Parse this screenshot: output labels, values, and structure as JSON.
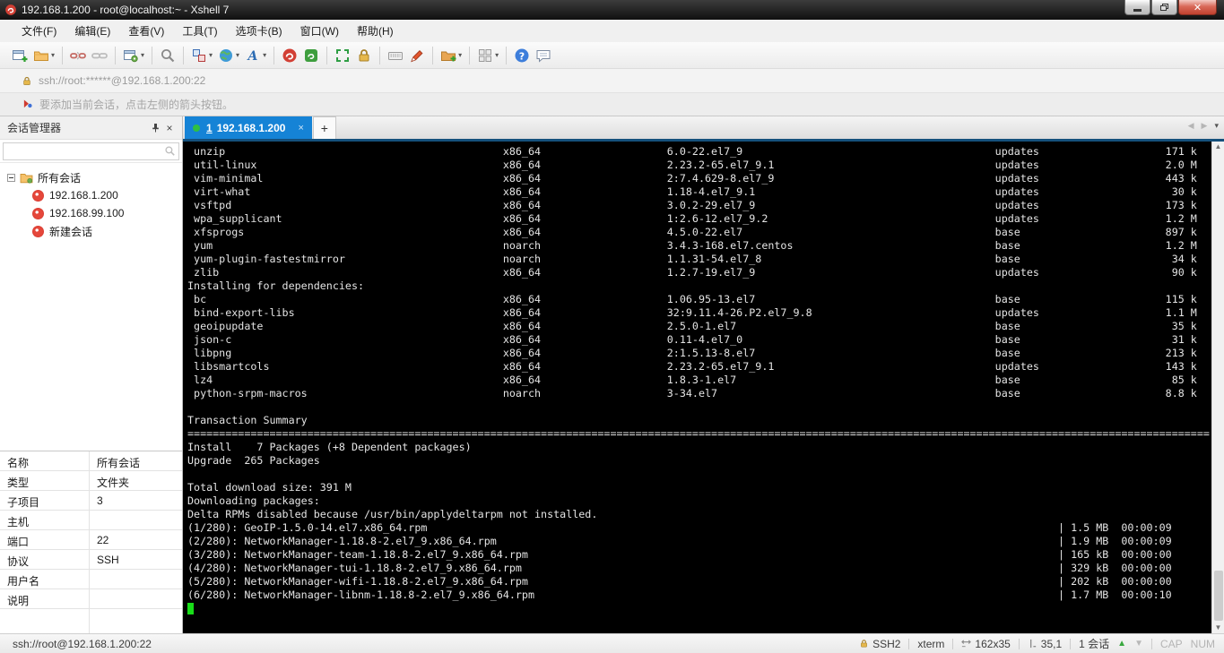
{
  "window": {
    "title": "192.168.1.200 - root@localhost:~ - Xshell 7"
  },
  "menu": {
    "items": [
      "文件(F)",
      "编辑(E)",
      "查看(V)",
      "工具(T)",
      "选项卡(B)",
      "窗口(W)",
      "帮助(H)"
    ]
  },
  "toolbar": {
    "icons": [
      "new-session",
      "open-folder",
      "disconnect",
      "reconnect",
      "session-properties",
      "find",
      "layout-panes",
      "web-browser",
      "font",
      "new-xshell-session",
      "new-xftp-session",
      "fullscreen",
      "lock-screen",
      "virtual-keyboard",
      "highlighter",
      "file-transfer",
      "tile-windows",
      "help",
      "feedback"
    ]
  },
  "address_bar": {
    "value": "ssh://root:******@192.168.1.200:22"
  },
  "info_bar": {
    "text": "要添加当前会话，点击左侧的箭头按钮。"
  },
  "session_manager": {
    "title": "会话管理器",
    "search_value": "",
    "tree": {
      "root": "所有会话",
      "sessions": [
        "192.168.1.200",
        "192.168.99.100",
        "新建会话"
      ]
    },
    "properties": [
      {
        "label": "名称",
        "value": "所有会话"
      },
      {
        "label": "类型",
        "value": "文件夹"
      },
      {
        "label": "子项目",
        "value": "3"
      },
      {
        "label": "主机",
        "value": ""
      },
      {
        "label": "端口",
        "value": "22"
      },
      {
        "label": "协议",
        "value": "SSH"
      },
      {
        "label": "用户名",
        "value": ""
      },
      {
        "label": "说明",
        "value": ""
      }
    ]
  },
  "tabs": {
    "active_index": "1",
    "active_label": "192.168.1.200",
    "close": "×",
    "new_tab": "+"
  },
  "terminal": {
    "columns": 162,
    "sep_char": "=",
    "lines": [
      {
        "t": "pkg",
        "name": "unzip",
        "arch": "x86_64",
        "ver": "6.0-22.el7_9",
        "repo": "updates",
        "size": "171 k"
      },
      {
        "t": "pkg",
        "name": "util-linux",
        "arch": "x86_64",
        "ver": "2.23.2-65.el7_9.1",
        "repo": "updates",
        "size": "2.0 M"
      },
      {
        "t": "pkg",
        "name": "vim-minimal",
        "arch": "x86_64",
        "ver": "2:7.4.629-8.el7_9",
        "repo": "updates",
        "size": "443 k"
      },
      {
        "t": "pkg",
        "name": "virt-what",
        "arch": "x86_64",
        "ver": "1.18-4.el7_9.1",
        "repo": "updates",
        "size": "30 k"
      },
      {
        "t": "pkg",
        "name": "vsftpd",
        "arch": "x86_64",
        "ver": "3.0.2-29.el7_9",
        "repo": "updates",
        "size": "173 k"
      },
      {
        "t": "pkg",
        "name": "wpa_supplicant",
        "arch": "x86_64",
        "ver": "1:2.6-12.el7_9.2",
        "repo": "updates",
        "size": "1.2 M"
      },
      {
        "t": "pkg",
        "name": "xfsprogs",
        "arch": "x86_64",
        "ver": "4.5.0-22.el7",
        "repo": "base",
        "size": "897 k"
      },
      {
        "t": "pkg",
        "name": "yum",
        "arch": "noarch",
        "ver": "3.4.3-168.el7.centos",
        "repo": "base",
        "size": "1.2 M"
      },
      {
        "t": "pkg",
        "name": "yum-plugin-fastestmirror",
        "arch": "noarch",
        "ver": "1.1.31-54.el7_8",
        "repo": "base",
        "size": "34 k"
      },
      {
        "t": "pkg",
        "name": "zlib",
        "arch": "x86_64",
        "ver": "1.2.7-19.el7_9",
        "repo": "updates",
        "size": "90 k"
      },
      {
        "t": "txt",
        "text": "Installing for dependencies:"
      },
      {
        "t": "pkg",
        "name": "bc",
        "arch": "x86_64",
        "ver": "1.06.95-13.el7",
        "repo": "base",
        "size": "115 k"
      },
      {
        "t": "pkg",
        "name": "bind-export-libs",
        "arch": "x86_64",
        "ver": "32:9.11.4-26.P2.el7_9.8",
        "repo": "updates",
        "size": "1.1 M"
      },
      {
        "t": "pkg",
        "name": "geoipupdate",
        "arch": "x86_64",
        "ver": "2.5.0-1.el7",
        "repo": "base",
        "size": "35 k"
      },
      {
        "t": "pkg",
        "name": "json-c",
        "arch": "x86_64",
        "ver": "0.11-4.el7_0",
        "repo": "base",
        "size": "31 k"
      },
      {
        "t": "pkg",
        "name": "libpng",
        "arch": "x86_64",
        "ver": "2:1.5.13-8.el7",
        "repo": "base",
        "size": "213 k"
      },
      {
        "t": "pkg",
        "name": "libsmartcols",
        "arch": "x86_64",
        "ver": "2.23.2-65.el7_9.1",
        "repo": "updates",
        "size": "143 k"
      },
      {
        "t": "pkg",
        "name": "lz4",
        "arch": "x86_64",
        "ver": "1.8.3-1.el7",
        "repo": "base",
        "size": "85 k"
      },
      {
        "t": "pkg",
        "name": "python-srpm-macros",
        "arch": "noarch",
        "ver": "3-34.el7",
        "repo": "base",
        "size": "8.8 k"
      },
      {
        "t": "blank"
      },
      {
        "t": "txt",
        "text": "Transaction Summary"
      },
      {
        "t": "sep"
      },
      {
        "t": "txt",
        "text": "Install    7 Packages (+8 Dependent packages)"
      },
      {
        "t": "txt",
        "text": "Upgrade  265 Packages"
      },
      {
        "t": "blank"
      },
      {
        "t": "txt",
        "text": "Total download size: 391 M"
      },
      {
        "t": "txt",
        "text": "Downloading packages:"
      },
      {
        "t": "txt",
        "text": "Delta RPMs disabled because /usr/bin/applydeltarpm not installed."
      },
      {
        "t": "dl",
        "name": "(1/280): GeoIP-1.5.0-14.el7.x86_64.rpm",
        "size": "1.5 MB",
        "time": "00:00:09"
      },
      {
        "t": "dl",
        "name": "(2/280): NetworkManager-1.18.8-2.el7_9.x86_64.rpm",
        "size": "1.9 MB",
        "time": "00:00:09"
      },
      {
        "t": "dl",
        "name": "(3/280): NetworkManager-team-1.18.8-2.el7_9.x86_64.rpm",
        "size": "165 kB",
        "time": "00:00:00"
      },
      {
        "t": "dl",
        "name": "(4/280): NetworkManager-tui-1.18.8-2.el7_9.x86_64.rpm",
        "size": "329 kB",
        "time": "00:00:00"
      },
      {
        "t": "dl",
        "name": "(5/280): NetworkManager-wifi-1.18.8-2.el7_9.x86_64.rpm",
        "size": "202 kB",
        "time": "00:00:00"
      },
      {
        "t": "dl",
        "name": "(6/280): NetworkManager-libnm-1.18.8-2.el7_9.x86_64.rpm",
        "size": "1.7 MB",
        "time": "00:00:10"
      },
      {
        "t": "cursor"
      }
    ]
  },
  "status_bar": {
    "left": "ssh://root@192.168.1.200:22",
    "encryption": "SSH2",
    "term_type": "xterm",
    "size": "162x35",
    "cursor_pos": "35,1",
    "sessions_count": "1 会话",
    "cap": "CAP",
    "num": "NUM"
  },
  "colors": {
    "accent_tab": "#1583d6",
    "tab_strip": "#15507c",
    "terminal_bg": "#000000",
    "terminal_fg": "#e4e4e4",
    "cursor_green": "#18dd18",
    "brand_red": "#d23f34"
  }
}
